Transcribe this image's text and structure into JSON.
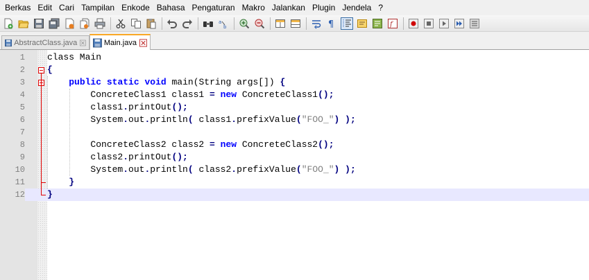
{
  "menubar": {
    "items": [
      "Berkas",
      "Edit",
      "Cari",
      "Tampilan",
      "Enkode",
      "Bahasa",
      "Pengaturan",
      "Makro",
      "Jalankan",
      "Plugin",
      "Jendela",
      "?"
    ]
  },
  "tabs": [
    {
      "label": "AbstractClass.java",
      "active": false
    },
    {
      "label": "Main.java",
      "active": true
    }
  ],
  "editor": {
    "line_numbers": [
      "1",
      "2",
      "3",
      "4",
      "5",
      "6",
      "7",
      "8",
      "9",
      "10",
      "11",
      "12"
    ],
    "current_line": 12,
    "lines": [
      {
        "tokens": [
          {
            "t": "class Main",
            "c": "plain"
          }
        ]
      },
      {
        "tokens": [
          {
            "t": "{",
            "c": "op"
          }
        ]
      },
      {
        "tokens": [
          {
            "t": "    ",
            "c": "plain"
          },
          {
            "t": "public",
            "c": "kw"
          },
          {
            "t": " ",
            "c": "plain"
          },
          {
            "t": "static",
            "c": "kw"
          },
          {
            "t": " ",
            "c": "plain"
          },
          {
            "t": "void",
            "c": "kw"
          },
          {
            "t": " main(String args[]) ",
            "c": "plain"
          },
          {
            "t": "{",
            "c": "op"
          }
        ]
      },
      {
        "tokens": [
          {
            "t": "        ConcreteClass1 class1 ",
            "c": "plain"
          },
          {
            "t": "=",
            "c": "op"
          },
          {
            "t": " ",
            "c": "plain"
          },
          {
            "t": "new",
            "c": "kw"
          },
          {
            "t": " ConcreteClass1",
            "c": "plain"
          },
          {
            "t": "();",
            "c": "op"
          }
        ]
      },
      {
        "tokens": [
          {
            "t": "        class1",
            "c": "plain"
          },
          {
            "t": ".",
            "c": "op"
          },
          {
            "t": "printOut",
            "c": "plain"
          },
          {
            "t": "();",
            "c": "op"
          }
        ]
      },
      {
        "tokens": [
          {
            "t": "        System",
            "c": "plain"
          },
          {
            "t": ".",
            "c": "op"
          },
          {
            "t": "out",
            "c": "plain"
          },
          {
            "t": ".",
            "c": "op"
          },
          {
            "t": "println",
            "c": "plain"
          },
          {
            "t": "(",
            "c": "op"
          },
          {
            "t": " class1",
            "c": "plain"
          },
          {
            "t": ".",
            "c": "op"
          },
          {
            "t": "prefixValue",
            "c": "plain"
          },
          {
            "t": "(",
            "c": "op"
          },
          {
            "t": "\"FOO_\"",
            "c": "str"
          },
          {
            "t": ")",
            "c": "op"
          },
          {
            "t": " ",
            "c": "plain"
          },
          {
            "t": ");",
            "c": "op"
          }
        ]
      },
      {
        "tokens": []
      },
      {
        "tokens": [
          {
            "t": "        ConcreteClass2 class2 ",
            "c": "plain"
          },
          {
            "t": "=",
            "c": "op"
          },
          {
            "t": " ",
            "c": "plain"
          },
          {
            "t": "new",
            "c": "kw"
          },
          {
            "t": " ConcreteClass2",
            "c": "plain"
          },
          {
            "t": "();",
            "c": "op"
          }
        ]
      },
      {
        "tokens": [
          {
            "t": "        class2",
            "c": "plain"
          },
          {
            "t": ".",
            "c": "op"
          },
          {
            "t": "printOut",
            "c": "plain"
          },
          {
            "t": "();",
            "c": "op"
          }
        ]
      },
      {
        "tokens": [
          {
            "t": "        System",
            "c": "plain"
          },
          {
            "t": ".",
            "c": "op"
          },
          {
            "t": "out",
            "c": "plain"
          },
          {
            "t": ".",
            "c": "op"
          },
          {
            "t": "println",
            "c": "plain"
          },
          {
            "t": "(",
            "c": "op"
          },
          {
            "t": " class2",
            "c": "plain"
          },
          {
            "t": ".",
            "c": "op"
          },
          {
            "t": "prefixValue",
            "c": "plain"
          },
          {
            "t": "(",
            "c": "op"
          },
          {
            "t": "\"FOO_\"",
            "c": "str"
          },
          {
            "t": ")",
            "c": "op"
          },
          {
            "t": " ",
            "c": "plain"
          },
          {
            "t": ");",
            "c": "op"
          }
        ]
      },
      {
        "tokens": [
          {
            "t": "    ",
            "c": "plain"
          },
          {
            "t": "}",
            "c": "op"
          }
        ]
      },
      {
        "tokens": [
          {
            "t": "}",
            "c": "op"
          }
        ]
      }
    ]
  },
  "icons": [
    "new-file-icon",
    "open-file-icon",
    "save-icon",
    "save-all-icon",
    "close-icon",
    "close-all-icon",
    "print-icon",
    "cut-icon",
    "copy-icon",
    "paste-icon",
    "undo-icon",
    "redo-icon",
    "find-icon",
    "replace-icon",
    "zoom-in-icon",
    "zoom-out-icon",
    "sync-vertical-icon",
    "sync-horizontal-icon",
    "word-wrap-icon",
    "show-all-chars-icon",
    "indent-guide-icon",
    "udl-icon",
    "doc-map-icon",
    "function-list-icon",
    "record-macro-icon",
    "stop-record-icon",
    "play-macro-icon",
    "play-multiple-icon",
    "save-macro-icon"
  ],
  "colors": {
    "keyword": "#0000ff",
    "operator": "#000080",
    "string": "#808080",
    "fold": "#e00000",
    "current_line": "#e8e8ff",
    "tab_accent": "#f9a825"
  }
}
